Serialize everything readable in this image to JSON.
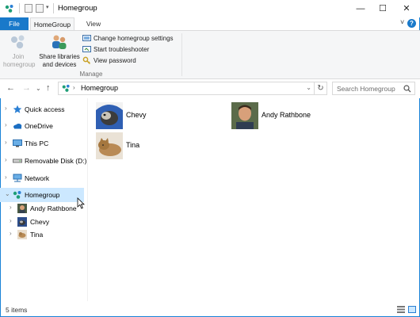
{
  "window": {
    "title": "Homegroup",
    "controls": {
      "minimize": "—",
      "maximize": "☐",
      "close": "✕"
    }
  },
  "ribbon_tabs": {
    "file": "File",
    "homegroup": "HomeGroup",
    "view": "View",
    "expand_glyph": "˅",
    "help_glyph": "?"
  },
  "ribbon": {
    "join_label_1": "Join",
    "join_label_2": "homegroup",
    "share_label_1": "Share libraries",
    "share_label_2": "and devices",
    "change_settings": "Change homegroup settings",
    "troubleshooter": "Start troubleshooter",
    "view_password": "View password",
    "group_label": "Manage"
  },
  "address": {
    "crumb": "Homegroup",
    "search_placeholder": "Search Homegroup"
  },
  "nav": {
    "quick_access": "Quick access",
    "onedrive": "OneDrive",
    "this_pc": "This PC",
    "removable": "Removable Disk (D:)",
    "network": "Network",
    "homegroup": "Homegroup",
    "sub": [
      "Andy Rathbone",
      "Chevy",
      "Tina"
    ]
  },
  "content": {
    "items": [
      "Chevy",
      "Andy Rathbone",
      "Tina"
    ]
  },
  "status": {
    "count": "5 items"
  },
  "colors": {
    "accent": "#1979ca",
    "selection": "#cce8ff",
    "frame": "#1883d7"
  }
}
